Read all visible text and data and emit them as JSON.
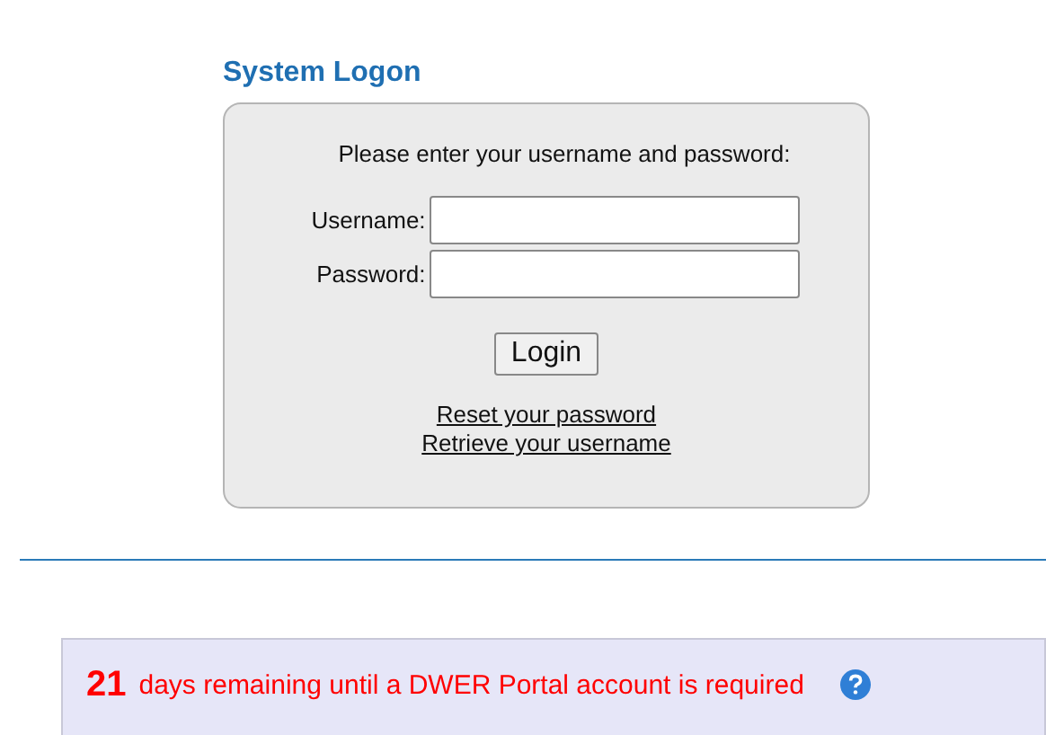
{
  "title": "System Logon",
  "logon": {
    "prompt": "Please enter your username and password:",
    "fields": [
      {
        "label": "Username:"
      },
      {
        "label": "Password:"
      }
    ],
    "button": "Login",
    "links": [
      "Reset your password",
      "Retrieve your username"
    ]
  },
  "notice": {
    "count": "21",
    "message": "days remaining until a DWER Portal account is required"
  }
}
